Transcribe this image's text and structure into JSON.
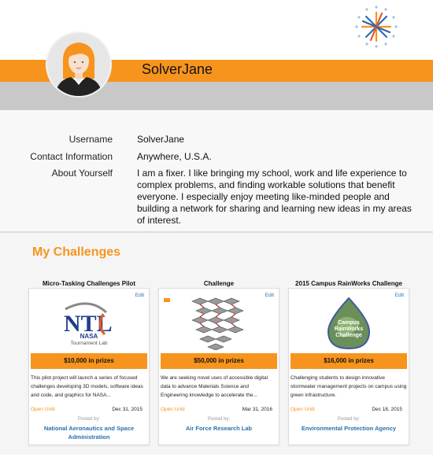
{
  "profile": {
    "display_name": "SolverJane",
    "fields": [
      {
        "label": "Username",
        "value": "SolverJane"
      },
      {
        "label": "Contact Information",
        "value": "Anywhere, U.S.A."
      },
      {
        "label": "About Yourself",
        "value": "I am a fixer. I like bringing my school, work and life experience to complex problems, and finding workable solutions that benefit everyone. I especially enjoy meeting like-minded people and building a network for sharing and learning new ideas in my areas of interest."
      }
    ]
  },
  "challenges": {
    "section_title": "My Challenges",
    "edit_label": "Edit",
    "open_until_label": "Open Until",
    "posted_by_label": "Posted by:",
    "items": [
      {
        "title": "Micro-Tasking Challenges Pilot",
        "image_text": "NASA",
        "image_subtext": "Tournament Lab",
        "prize": "$10,000 in prizes",
        "description": "This pilot project will launch a series of focused challenges developing 3D models, software ideas and code, and graphics for NASA...",
        "close_date": "Dec 31, 2015",
        "organization": "National Aeronautics and Space Administration"
      },
      {
        "title": "Challenge",
        "prize": "$50,000 in prizes",
        "description": "We are seeking novel uses of accessible digital data to advance Materials Science and Engineering knowledge to accelerate the...",
        "close_date": "Mar 31, 2016",
        "organization": "Air Force Research Lab"
      },
      {
        "title": "2015 Campus RainWorks Challenge",
        "image_text": "Campus RainWorks Challenge",
        "prize": "$16,000 in prizes",
        "description": "Challenging students to design innovative stormwater management projects on campus using green infrastructure.",
        "close_date": "Dec 18, 2015",
        "organization": "Environmental Protection Agency"
      }
    ]
  },
  "colors": {
    "accent": "#f7941d",
    "link": "#2a6fb0",
    "band_gray": "#c8c8c8"
  },
  "icons": [
    "starburst-logo-icon",
    "avatar-icon"
  ]
}
